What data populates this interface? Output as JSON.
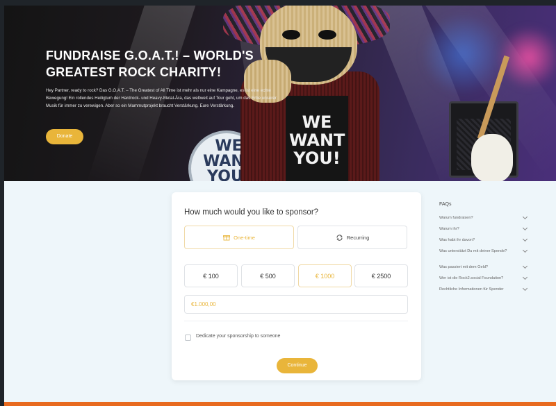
{
  "hero": {
    "title": "FUNDRAISE G.O.A.T.! – WORLD'S GREATEST ROCK CHARITY!",
    "description": "Hey Partner, ready to rock? Das G.O.A.T. – The Greatest of All Time ist mehr als nur eine Kampagne, es ist eine echte Bewegung! Ein rollendes Heiligtum der Hardrock- und Heavy-Metal-Ära, das weltweit auf Tour geht, um das Erbe unserer Musik für immer zu verewigen. Aber so ein Mammutprojekt braucht Verstärkung. Eure Verstärkung.",
    "donate_label": "Donate",
    "shirt_text": "WE WANT YOU!",
    "drum_text": "WE WANT YOU!"
  },
  "sponsor": {
    "title": "How much would you like to sponsor?",
    "frequency": [
      {
        "label": "One-time",
        "icon": "gift-icon",
        "selected": true
      },
      {
        "label": "Recurring",
        "icon": "recurring-icon",
        "selected": false
      }
    ],
    "amounts": [
      {
        "label": "€ 100",
        "selected": false
      },
      {
        "label": "€ 500",
        "selected": false
      },
      {
        "label": "€ 1000",
        "selected": true
      },
      {
        "label": "€ 2500",
        "selected": false
      }
    ],
    "amount_value": "€1.000,00",
    "dedicate_label": "Dedicate your sponsorship to someone",
    "dedicate_checked": false,
    "continue_label": "Continue"
  },
  "faqs": {
    "title": "FAQs",
    "items": [
      "Warum fundraisen?",
      "Warum ihr?",
      "Was habt ihr davon?",
      "Was unterstützt Du mit deiner Spende?",
      "Was passiert mit dem Geld?",
      "Wer ist die Rock2.social Foundation?",
      "Rechtliche Informationen für Spender"
    ]
  },
  "colors": {
    "accent": "#e9b53a",
    "bottom_bar": "#e86a1f",
    "page_bg": "#eef6fa"
  }
}
